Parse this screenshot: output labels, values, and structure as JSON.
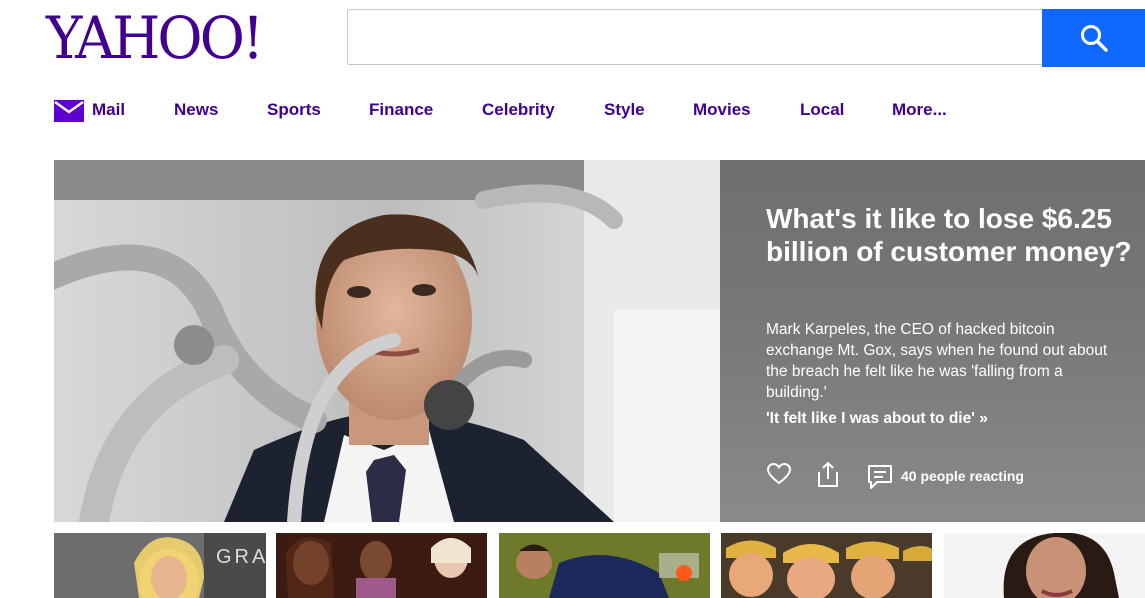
{
  "header": {
    "logo": "YAHOO!",
    "search": {
      "value": "",
      "placeholder": ""
    }
  },
  "nav": {
    "items": [
      {
        "label": "Mail"
      },
      {
        "label": "News"
      },
      {
        "label": "Sports"
      },
      {
        "label": "Finance"
      },
      {
        "label": "Celebrity"
      },
      {
        "label": "Style"
      },
      {
        "label": "Movies"
      },
      {
        "label": "Local"
      },
      {
        "label": "More..."
      }
    ]
  },
  "hero": {
    "title": "What's it like to lose $6.25 billion of customer money?",
    "summary": "Mark Karpeles, the CEO of hacked bitcoin exchange Mt. Gox, says when he found out about the breach he felt like he was 'falling from a building.'",
    "link": "'It felt like I was about to die' »",
    "reactions": "40 people reacting"
  },
  "thumbs": {
    "first_sign_text": "GRA"
  },
  "colors": {
    "brand": "#400090",
    "search_button": "#0f69ff",
    "hero_panel": "#767676"
  },
  "icons": [
    "search-icon",
    "mail-icon",
    "heart-icon",
    "share-icon",
    "comment-icon"
  ]
}
